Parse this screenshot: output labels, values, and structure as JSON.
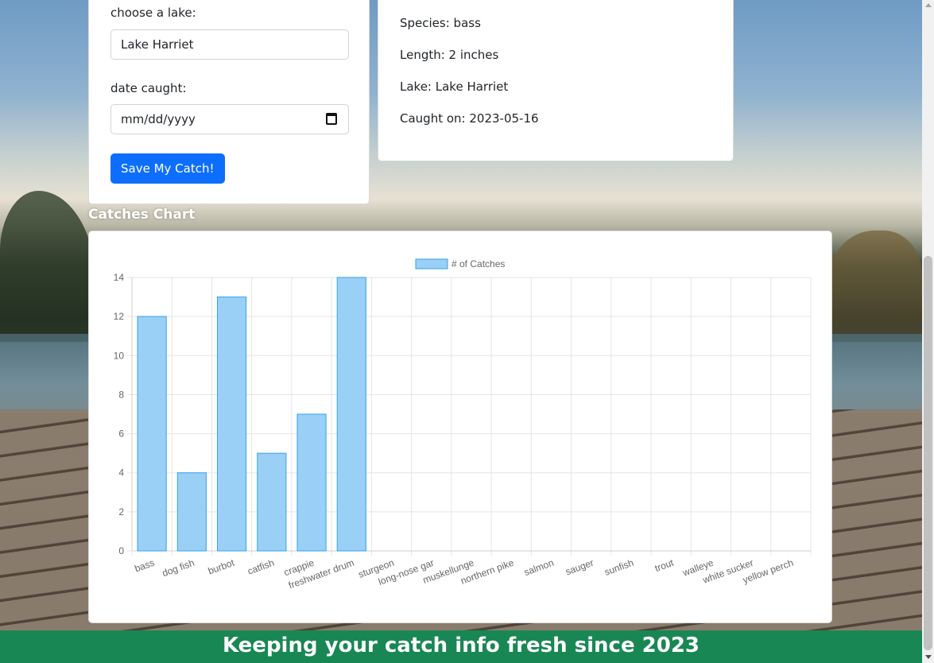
{
  "form": {
    "lake_label": "choose a lake:",
    "lake_value": "Lake Harriet",
    "date_label": "date caught:",
    "date_placeholder": "mm/dd/yyyy",
    "save_label": "Save My Catch!"
  },
  "catch_info": {
    "species": "Species: bass",
    "length": "Length: 2 inches",
    "lake": "Lake: Lake Harriet",
    "caught_on": "Caught on: 2023-05-16"
  },
  "chart_heading": "Catches Chart",
  "footer": "Keeping your catch info fresh since 2023",
  "colors": {
    "bar_fill": "#9ad0f5",
    "bar_border": "#36a2eb",
    "footer_bg": "#198754",
    "button_bg": "#0d6efd"
  },
  "chart_data": {
    "type": "bar",
    "legend": "# of Catches",
    "legend_position": "top-center",
    "grid": true,
    "ylim": [
      0,
      14
    ],
    "yticks": [
      0,
      2,
      4,
      6,
      8,
      10,
      12,
      14
    ],
    "categories": [
      "bass",
      "dog fish",
      "burbot",
      "catfish",
      "crappie",
      "freshwater drum",
      "sturgeon",
      "long-nose gar",
      "muskellunge",
      "northern pike",
      "salmon",
      "sauger",
      "sunfish",
      "trout",
      "walleye",
      "white sucker",
      "yellow perch"
    ],
    "series": [
      {
        "name": "# of Catches",
        "values": [
          12,
          4,
          13,
          5,
          7,
          14,
          0,
          0,
          0,
          0,
          0,
          0,
          0,
          0,
          0,
          0,
          0
        ]
      }
    ]
  }
}
